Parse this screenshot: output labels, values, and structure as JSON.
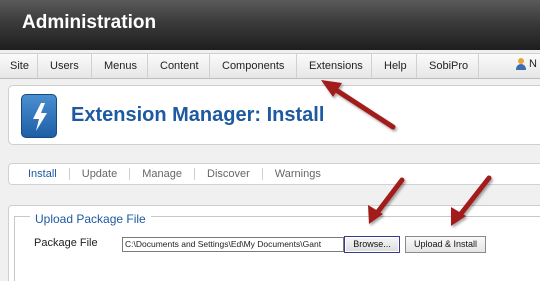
{
  "header": {
    "title": "Administration"
  },
  "menubar": {
    "items": [
      {
        "label": "Site"
      },
      {
        "label": "Users"
      },
      {
        "label": "Menus"
      },
      {
        "label": "Content"
      },
      {
        "label": "Components"
      },
      {
        "label": "Extensions"
      },
      {
        "label": "Help"
      },
      {
        "label": "SobiPro"
      }
    ],
    "user_label": "N"
  },
  "page": {
    "title": "Extension Manager: Install",
    "icon": "lightning-icon"
  },
  "subnav": {
    "tabs": [
      {
        "label": "Install",
        "active": true
      },
      {
        "label": "Update"
      },
      {
        "label": "Manage"
      },
      {
        "label": "Discover"
      },
      {
        "label": "Warnings"
      }
    ]
  },
  "upload": {
    "legend": "Upload Package File",
    "field_label": "Package File",
    "file_value": "C:\\Documents and Settings\\Ed\\My Documents\\Gant",
    "browse_label": "Browse...",
    "install_label": "Upload & Install"
  },
  "colors": {
    "accent": "#1d5aa0",
    "arrow": "#a31f1f"
  }
}
